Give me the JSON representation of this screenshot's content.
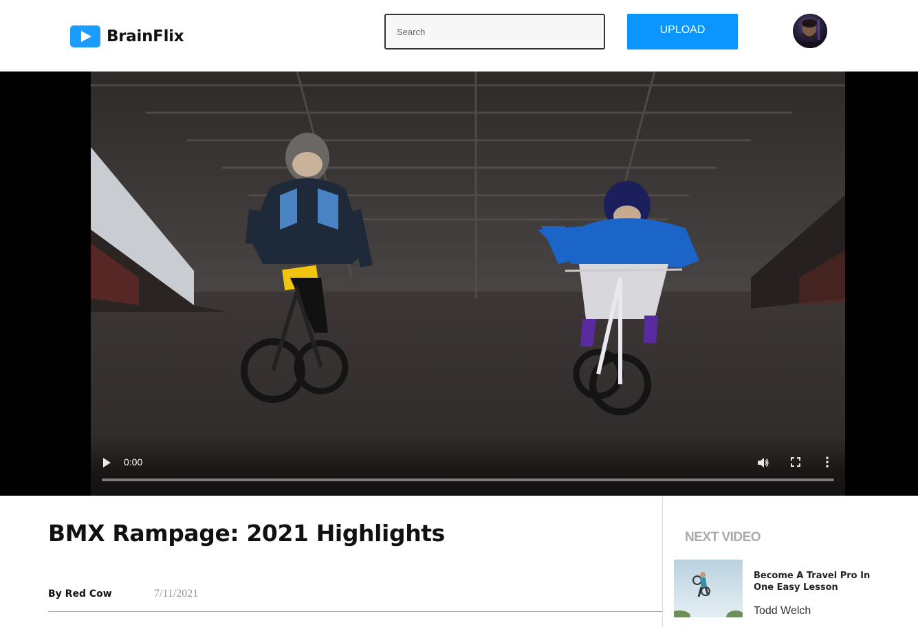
{
  "header": {
    "app_name": "BrainFlix",
    "search_placeholder": "Search",
    "upload_label": "UPLOAD"
  },
  "player": {
    "current_time": "0:00",
    "progress": 0
  },
  "video": {
    "title": "BMX Rampage: 2021 Highlights",
    "byline": "By Red Cow",
    "date": "7/11/2021"
  },
  "sidebar": {
    "heading": "NEXT VIDEO",
    "items": [
      {
        "title": "Become A Travel Pro In One Easy Lesson",
        "author": "Todd Welch"
      }
    ]
  },
  "colors": {
    "accent": "#0a95ff",
    "logo": "#1a9dff"
  }
}
